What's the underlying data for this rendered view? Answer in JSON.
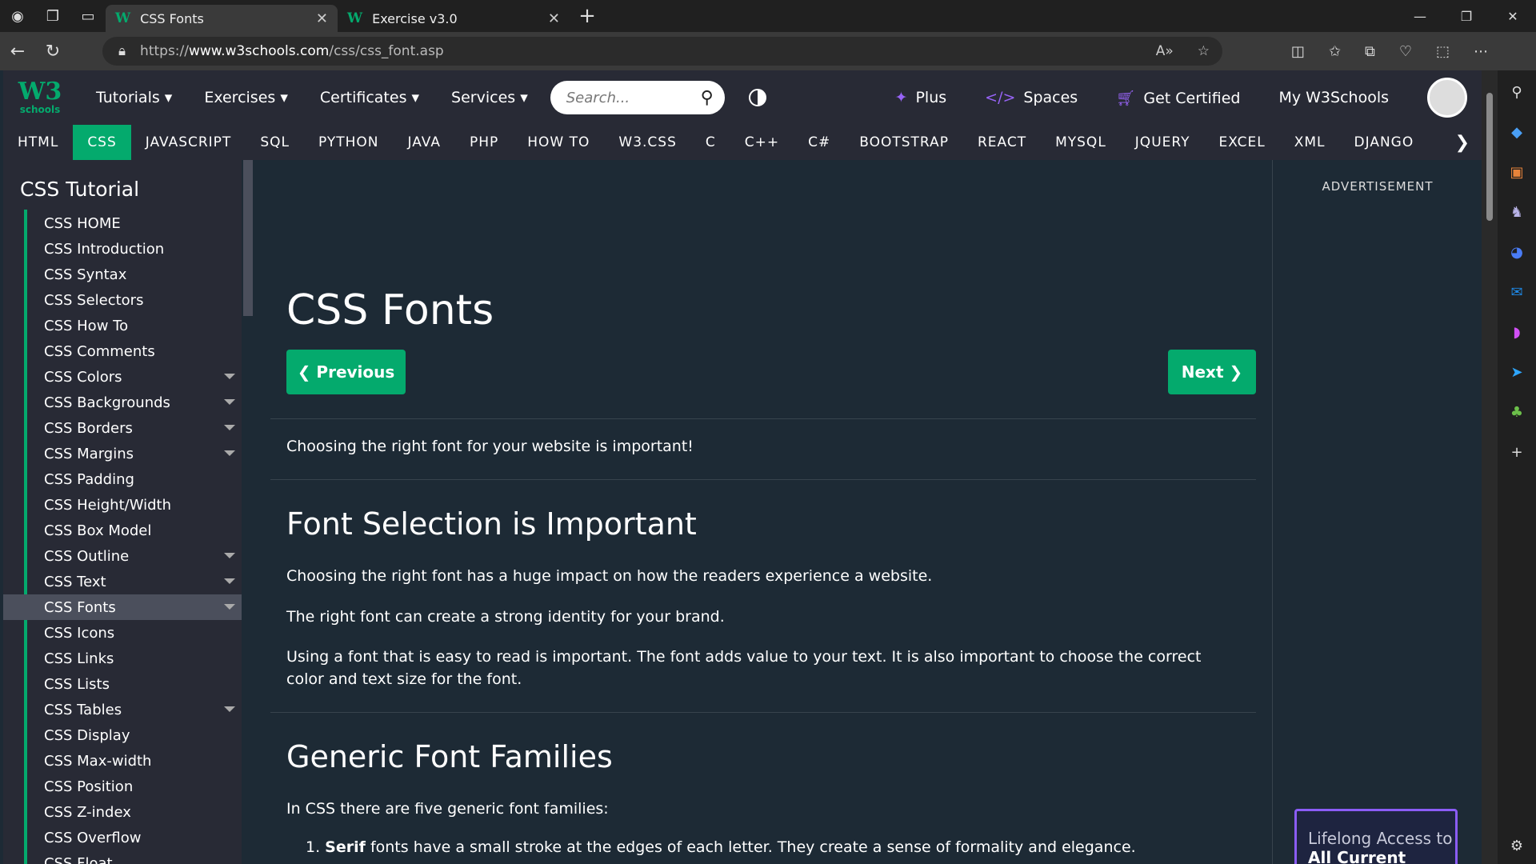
{
  "browser": {
    "tabs": [
      {
        "title": "CSS Fonts",
        "active": true
      },
      {
        "title": "Exercise v3.0",
        "active": false
      }
    ],
    "url": {
      "scheme": "https://",
      "host": "www.w3schools.com",
      "path": "/css/css_font.asp"
    }
  },
  "w3nav": {
    "logo_text": "W3",
    "logo_sub": "schools",
    "menu": [
      "Tutorials",
      "Exercises",
      "Certificates",
      "Services"
    ],
    "search_placeholder": "Search...",
    "right": {
      "plus": "Plus",
      "spaces": "Spaces",
      "certified": "Get Certified",
      "my": "My W3Schools"
    }
  },
  "subjects": [
    "HTML",
    "CSS",
    "JAVASCRIPT",
    "SQL",
    "PYTHON",
    "JAVA",
    "PHP",
    "HOW TO",
    "W3.CSS",
    "C",
    "C++",
    "C#",
    "BOOTSTRAP",
    "REACT",
    "MYSQL",
    "JQUERY",
    "EXCEL",
    "XML",
    "DJANGO"
  ],
  "active_subject": "CSS",
  "sidebar": {
    "title": "CSS Tutorial",
    "items": [
      {
        "label": "CSS HOME",
        "caret": false
      },
      {
        "label": "CSS Introduction",
        "caret": false
      },
      {
        "label": "CSS Syntax",
        "caret": false
      },
      {
        "label": "CSS Selectors",
        "caret": false
      },
      {
        "label": "CSS How To",
        "caret": false
      },
      {
        "label": "CSS Comments",
        "caret": false
      },
      {
        "label": "CSS Colors",
        "caret": true
      },
      {
        "label": "CSS Backgrounds",
        "caret": true
      },
      {
        "label": "CSS Borders",
        "caret": true
      },
      {
        "label": "CSS Margins",
        "caret": true
      },
      {
        "label": "CSS Padding",
        "caret": false
      },
      {
        "label": "CSS Height/Width",
        "caret": false
      },
      {
        "label": "CSS Box Model",
        "caret": false
      },
      {
        "label": "CSS Outline",
        "caret": true
      },
      {
        "label": "CSS Text",
        "caret": true
      },
      {
        "label": "CSS Fonts",
        "caret": true,
        "active": true
      },
      {
        "label": "CSS Icons",
        "caret": false
      },
      {
        "label": "CSS Links",
        "caret": false
      },
      {
        "label": "CSS Lists",
        "caret": false
      },
      {
        "label": "CSS Tables",
        "caret": true
      },
      {
        "label": "CSS Display",
        "caret": false
      },
      {
        "label": "CSS Max-width",
        "caret": false
      },
      {
        "label": "CSS Position",
        "caret": false
      },
      {
        "label": "CSS Z-index",
        "caret": false
      },
      {
        "label": "CSS Overflow",
        "caret": false
      },
      {
        "label": "CSS Float",
        "caret": false
      }
    ]
  },
  "main": {
    "title": "CSS Fonts",
    "prev_label": "❮ Previous",
    "next_label": "Next ❯",
    "intro": "Choosing the right font for your website is important!",
    "section1": {
      "heading": "Font Selection is Important",
      "p1": "Choosing the right font has a huge impact on how the readers experience a website.",
      "p2": "The right font can create a strong identity for your brand.",
      "p3": "Using a font that is easy to read is important. The font adds value to your text. It is also important to choose the correct color and text size for the font."
    },
    "section2": {
      "heading": "Generic Font Families",
      "p1": "In CSS there are five generic font families:",
      "list_item1_bold": "Serif",
      "list_item1_rest": " fonts have a small stroke at the edges of each letter. They create a sense of formality and elegance."
    }
  },
  "ad": {
    "label": "ADVERTISEMENT",
    "box_text": "Lifelong Access to",
    "box_text2": "All Current"
  }
}
